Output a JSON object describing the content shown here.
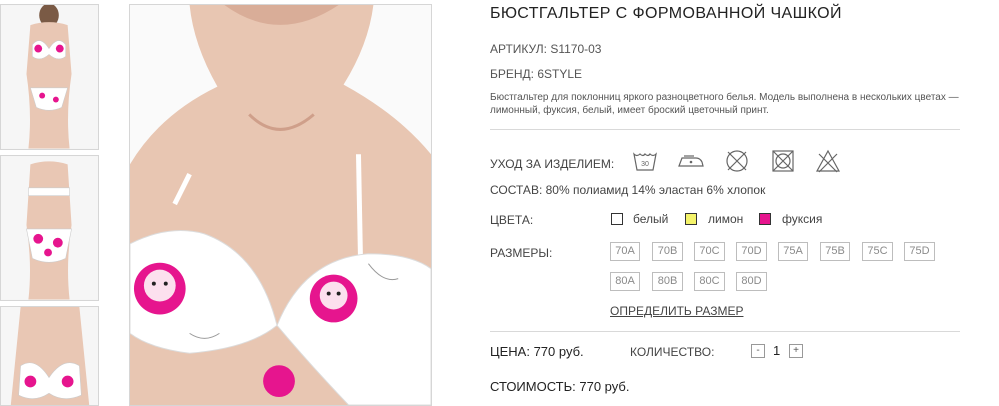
{
  "product": {
    "title": "БЮСТГАЛЬТЕР С ФОРМОВАННОЙ ЧАШКОЙ",
    "article_label": "АРТИКУЛ:",
    "article_value": "S1170-03",
    "brand_label": "БРЕНД:",
    "brand_value": "6STYLE",
    "description": "Бюстгальтер для поклонниц яркого разноцветного белья. Модель выполнена в нескольких цветах — лимонный, фуксия, белый, имеет броский цветочный принт."
  },
  "care": {
    "label": "УХОД ЗА ИЗДЕЛИЕМ:",
    "icons": [
      "wash-30-icon",
      "iron-low-icon",
      "no-dry-clean-icon",
      "no-tumble-dry-icon",
      "no-bleach-icon"
    ]
  },
  "composition": "СОСТАВ: 80% полиамид 14% эластан 6% хлопок",
  "colors": {
    "label": "ЦВЕТА:",
    "items": [
      {
        "name": "белый",
        "hex": "#ffffff"
      },
      {
        "name": "лимон",
        "hex": "#f4f36a"
      },
      {
        "name": "фуксия",
        "hex": "#e6158e"
      }
    ]
  },
  "sizes": {
    "label": "РАЗМЕРЫ:",
    "items": [
      "70A",
      "70B",
      "70C",
      "70D",
      "75A",
      "75B",
      "75C",
      "75D",
      "80A",
      "80B",
      "80C",
      "80D"
    ],
    "size_guide": "ОПРЕДЕЛИТЬ РАЗМЕР"
  },
  "order": {
    "price": "ЦЕНА: 770 руб.",
    "qty_label": "КОЛИЧЕСТВО:",
    "qty_minus": "-",
    "qty_value": "1",
    "qty_plus": "+",
    "total": "СТОИМОСТЬ: 770 руб."
  },
  "theme": {
    "fuchsia": "#e6158e",
    "border": "#d6d6d6"
  }
}
